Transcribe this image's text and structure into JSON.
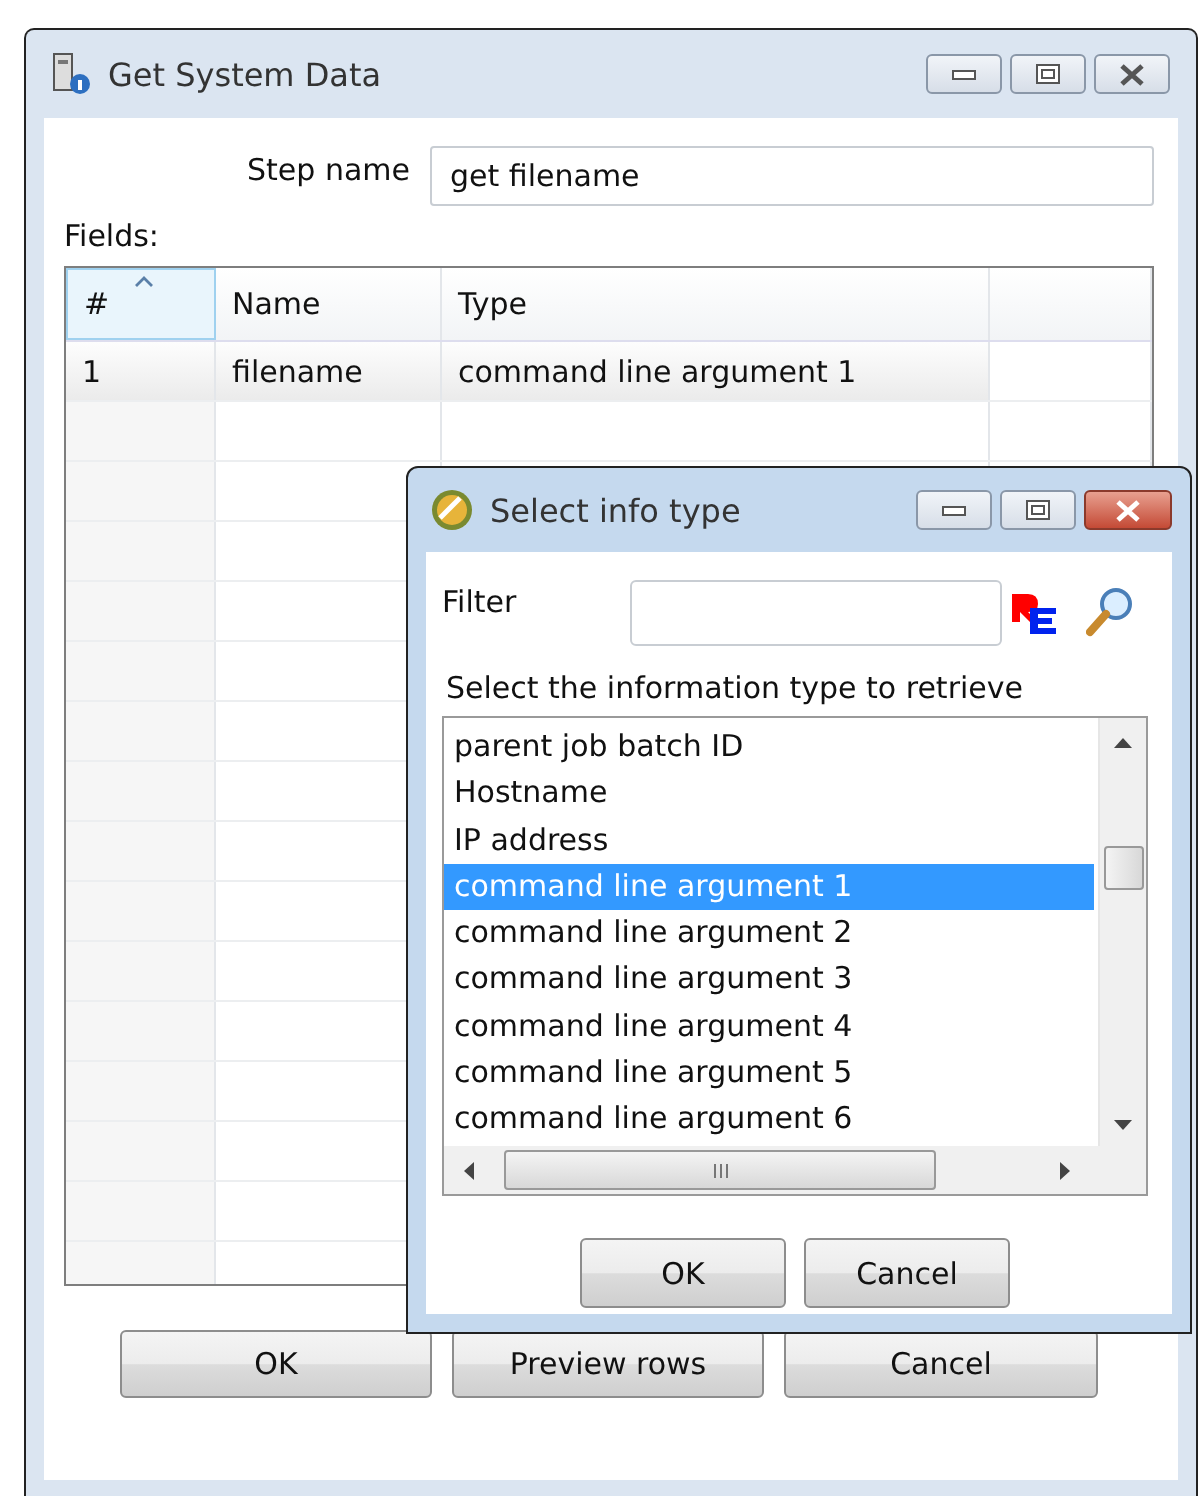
{
  "window": {
    "title": "Get System Data"
  },
  "step_name": {
    "label": "Step name",
    "value": "get filename"
  },
  "fields": {
    "label": "Fields:",
    "columns": [
      "#",
      "Name",
      "Type"
    ],
    "rows": [
      {
        "number": "1",
        "name": "filename",
        "type": "command line argument 1"
      }
    ]
  },
  "buttons": [
    "OK",
    "Preview rows",
    "Cancel"
  ],
  "dialog": {
    "title": "Select info type",
    "filter": {
      "label": "Filter"
    },
    "list_label": "Select the information type to retrieve",
    "items": [
      {
        "label": "parent job batch ID",
        "selected": false
      },
      {
        "label": "Hostname",
        "selected": false
      },
      {
        "label": "IP address",
        "selected": false
      },
      {
        "label": "command line argument 1",
        "selected": true
      },
      {
        "label": "command line argument 2",
        "selected": false
      },
      {
        "label": "command line argument 3",
        "selected": false
      },
      {
        "label": "command line argument 4",
        "selected": false
      },
      {
        "label": "command line argument 5",
        "selected": false
      },
      {
        "label": "command line argument 6",
        "selected": false
      }
    ],
    "buttons": [
      "OK",
      "Cancel"
    ]
  }
}
